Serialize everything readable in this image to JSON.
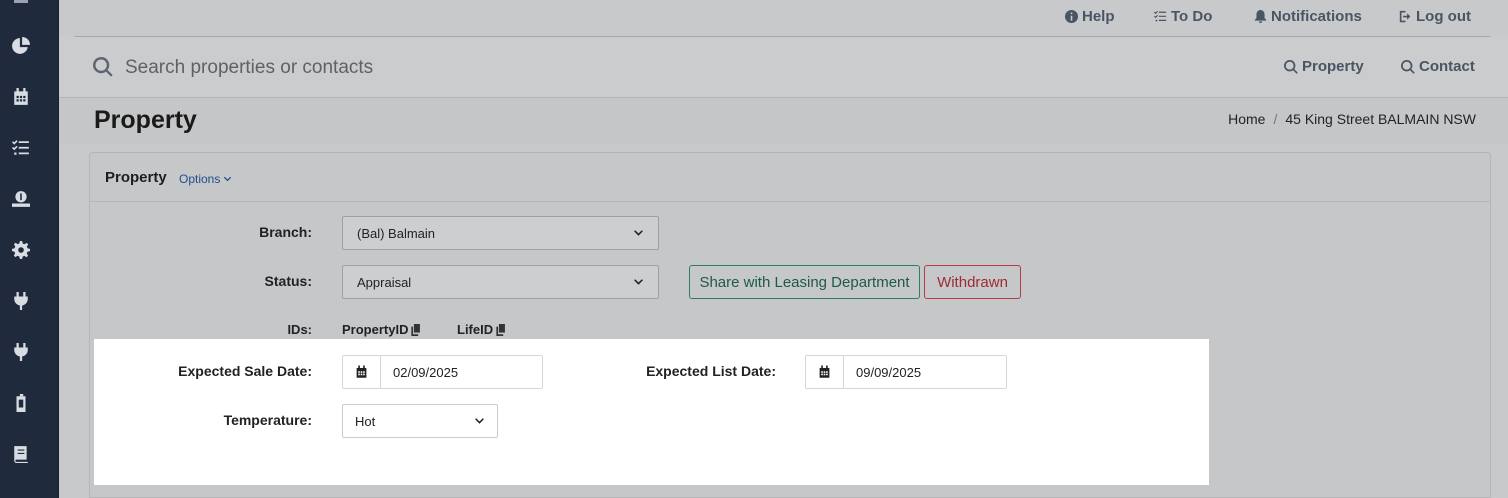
{
  "topbar": {
    "help": "Help",
    "todo": "To Do",
    "notifications": "Notifications",
    "logout": "Log out"
  },
  "search": {
    "placeholder": "Search properties or contacts",
    "tab_property": "Property",
    "tab_contact": "Contact"
  },
  "page": {
    "title": "Property",
    "breadcrumb": [
      "Home",
      "45 King Street BALMAIN NSW"
    ]
  },
  "card": {
    "title": "Property",
    "options": "Options"
  },
  "form": {
    "branch_label": "Branch:",
    "branch_value": "(Bal) Balmain",
    "status_label": "Status:",
    "status_value": "Appraisal",
    "share_button": "Share with Leasing Department",
    "withdrawn_button": "Withdrawn",
    "ids_label": "IDs:",
    "property_id": "PropertyID",
    "life_id": "LifeID",
    "expected_sale_label": "Expected Sale Date:",
    "expected_sale_value": "02/09/2025",
    "expected_list_label": "Expected List Date:",
    "expected_list_value": "09/09/2025",
    "temperature_label": "Temperature:",
    "temperature_value": "Hot"
  },
  "sidebar": {
    "icons": [
      "pie-chart-icon",
      "calendar-icon",
      "task-list-icon",
      "money-hand-icon",
      "gear-icon",
      "plug-icon",
      "plug-icon",
      "mobile-icon",
      "book-icon"
    ]
  },
  "colors": {
    "sidebar_bg": "#1f2a3d",
    "share_border": "#2e7d63",
    "withdrawn_border": "#b53b45",
    "options_link": "#1e4e8c"
  }
}
